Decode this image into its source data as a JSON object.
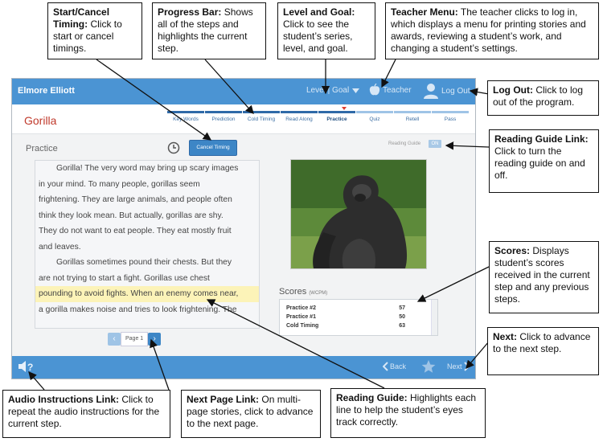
{
  "app": {
    "student_name": "Elmore Elliott",
    "level_goal": "Level | Goal",
    "teacher": "Teacher",
    "logout": "Log Out",
    "story_title": "Gorilla",
    "steps": [
      "Key Words",
      "Prediction",
      "Cold Timing",
      "Read Along",
      "Practice",
      "Quiz",
      "Retell",
      "Pass"
    ],
    "current_step": "Practice",
    "practice_label": "Practice",
    "cancel_timing": "Cancel Timing",
    "reading_guide_label": "Reading Guide",
    "reading_guide_state": "ON",
    "passage": {
      "p1": [
        "Gorilla! The very word may bring up scary images",
        "in your mind. To many people, gorillas seem",
        "frightening. They are large animals, and people often",
        "think they look mean. But actually, gorillas are shy.",
        "They do not want to eat people. They eat mostly fruit",
        "and leaves."
      ],
      "p2": [
        "Gorillas sometimes pound their chests. But they",
        "are not trying to start a fight. Gorillas use chest",
        "pounding to avoid fights. When an enemy comes near,",
        "a gorilla makes noise and tries to look frightening. The"
      ]
    },
    "page_label": "Page 1",
    "scores_title": "Scores",
    "scores_unit": "(WCPM)",
    "scores": [
      {
        "label": "Practice #2",
        "value": "57"
      },
      {
        "label": "Practice #1",
        "value": "50"
      },
      {
        "label": "Cold Timing",
        "value": "63"
      }
    ],
    "back": "Back",
    "next": "Next"
  },
  "callouts": {
    "start_cancel": {
      "title": "Start/Cancel Timing:",
      "text": "Click to start or cancel timings."
    },
    "progress_bar": {
      "title": "Progress Bar:",
      "text": "Shows all of the steps and highlights the current step."
    },
    "level_goal": {
      "title": "Level and Goal:",
      "text": "Click to see the student’s series, level, and goal."
    },
    "teacher_menu": {
      "title": "Teacher Menu:",
      "text": "The teacher clicks to log in, which displays a menu for printing stories and awards, reviewing a student’s work, and changing a student’s settings."
    },
    "log_out": {
      "title": "Log Out:",
      "text": "Click to log out of the program."
    },
    "reading_guide_link": {
      "title": "Reading Guide Link:",
      "text": "Click to turn the reading guide on and off."
    },
    "scores": {
      "title": "Scores:",
      "text": "Displays student’s scores received in the current step and any previous steps."
    },
    "next": {
      "title": "Next:",
      "text": "Click to advance to the next step."
    },
    "audio_instructions": {
      "title": "Audio Instructions Link:",
      "text": "Click to repeat the audio instructions for the current step."
    },
    "next_page": {
      "title": "Next Page Link:",
      "text": "On multi-page stories, click to advance to the next page."
    },
    "reading_guide": {
      "title": "Reading Guide:",
      "text": "Highlights each line to help the student’s eyes track correctly."
    }
  },
  "colors": {
    "header_blue": "#4b94d3",
    "title_red": "#c0392b",
    "highlight": "#fcf3b8"
  }
}
